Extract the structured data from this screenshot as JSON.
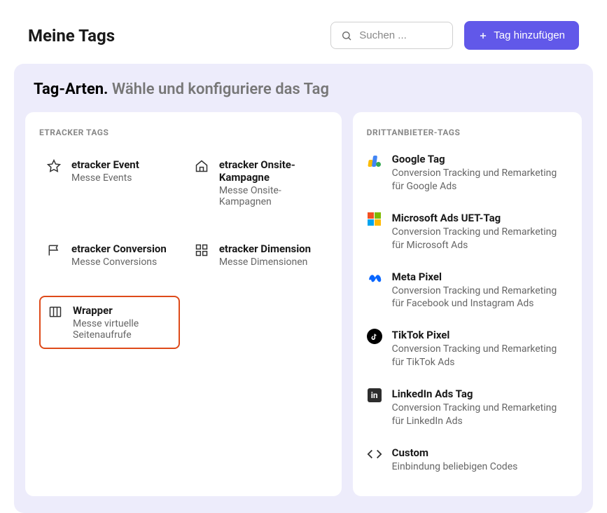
{
  "header": {
    "title": "Meine Tags",
    "search_placeholder": "Suchen ...",
    "add_button": "Tag hinzufügen"
  },
  "panel": {
    "title_strong": "Tag-Arten.",
    "title_light": "Wähle und konfiguriere das Tag"
  },
  "etracker": {
    "section": "ETRACKER TAGS",
    "items": [
      {
        "title": "etracker Event",
        "desc": "Messe Events",
        "icon": "star-icon"
      },
      {
        "title": "etracker Onsite-Kampagne",
        "desc": "Messe Onsite-Kampagnen",
        "icon": "house-icon"
      },
      {
        "title": "etracker Conversion",
        "desc": "Messe Conversions",
        "icon": "flag-icon"
      },
      {
        "title": "etracker Dimension",
        "desc": "Messe Dimensionen",
        "icon": "grid-icon"
      },
      {
        "title": "Wrapper",
        "desc": "Messe virtuelle Seitenaufrufe",
        "icon": "columns-icon",
        "selected": true
      }
    ]
  },
  "thirdparty": {
    "section": "DRITTANBIETER-TAGS",
    "items": [
      {
        "title": "Google Tag",
        "desc": "Conversion Tracking und Remarketing für Google Ads",
        "icon": "google-icon"
      },
      {
        "title": "Microsoft Ads UET-Tag",
        "desc": "Conversion Tracking und Remarketing für Microsoft Ads",
        "icon": "microsoft-icon"
      },
      {
        "title": "Meta Pixel",
        "desc": "Conversion Tracking und Remarketing für Facebook und Instagram Ads",
        "icon": "meta-icon"
      },
      {
        "title": "TikTok Pixel",
        "desc": "Conversion Tracking und Remarketing für TikTok Ads",
        "icon": "tiktok-icon"
      },
      {
        "title": "LinkedIn Ads Tag",
        "desc": "Conversion Tracking und Remarketing für LinkedIn Ads",
        "icon": "linkedin-icon"
      },
      {
        "title": "Custom",
        "desc": "Einbindung beliebigen Codes",
        "icon": "code-icon"
      }
    ]
  }
}
